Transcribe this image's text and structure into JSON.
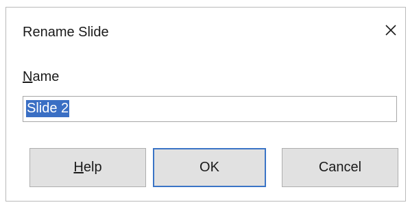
{
  "dialog": {
    "title": "Rename Slide",
    "close_icon": "close-icon"
  },
  "name": {
    "label_mnemonic": "N",
    "label_rest": "ame",
    "value": "Slide 2"
  },
  "buttons": {
    "help_mnemonic": "H",
    "help_rest": "elp",
    "ok_label": "OK",
    "cancel_label": "Cancel"
  },
  "colors": {
    "selection": "#3a6fc4",
    "default_button_border": "#3a74c6",
    "button_face": "#e1e1e1"
  }
}
